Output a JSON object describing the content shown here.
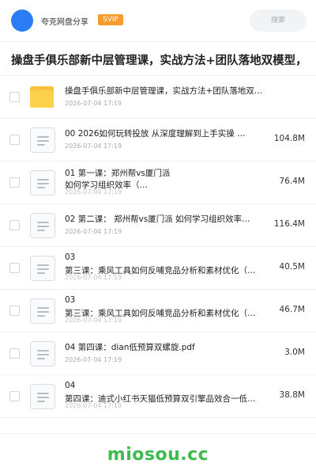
{
  "header": {
    "username": "夸克网盘分享",
    "vip_badge": "SVIP",
    "search_placeholder": "搜索"
  },
  "share_title": "操盘手俱乐部新中层管理课，实战方法+团队落地双模型，",
  "files": [
    {
      "type": "folder",
      "name_line1": "操盘手俱乐部新中层管理课，实战方法+团队落地双模型…",
      "name_line2": "",
      "date": "2026-07-04 17:19",
      "size": ""
    },
    {
      "type": "doc",
      "name_line1": "00 2026如何玩转投放 从深度理解到上手实操 …",
      "name_line2": "",
      "date": "2026-07-04 17:19",
      "size": "104.8M"
    },
    {
      "type": "doc",
      "name_line1": "01 第一课：郑州帮vs厦门派",
      "name_line2": "如何学习组织效率（…",
      "date": "2026-07-04 17:19",
      "size": "76.4M"
    },
    {
      "type": "doc",
      "name_line1": "02 第二课： 郑州帮vs厦门派 如何学习组织效率…",
      "name_line2": "",
      "date": "2026-07-04 17:19",
      "size": "116.4M"
    },
    {
      "type": "doc",
      "name_line1": "03",
      "name_line2": "第三课：乘风工具如何反哺竞品分析和素材优化（…",
      "date": "2026-07-04 17:19",
      "size": "40.5M"
    },
    {
      "type": "doc",
      "name_line1": "03",
      "name_line2": "第三课：乘风工具如何反哺竞品分析和素材优化（…",
      "date": "2026-07-04 17:19",
      "size": "46.7M"
    },
    {
      "type": "doc",
      "name_line1": "04 第四课：dian低预算双螺旋.pdf",
      "name_line2": "",
      "date": "2026-07-04 17:19",
      "size": "3.0M"
    },
    {
      "type": "doc",
      "name_line1": "04",
      "name_line2": "第四课：迪式小红书天猫低预算双引擎品效合一低…",
      "date": "2026-07-04 17:19",
      "size": "38.8M"
    }
  ],
  "brand": "miosou.cc",
  "colors": {
    "accent": "#2a7df7",
    "vip": "#f79b2d",
    "folder": "#fbd04a",
    "brand": "#3dbb4c"
  }
}
